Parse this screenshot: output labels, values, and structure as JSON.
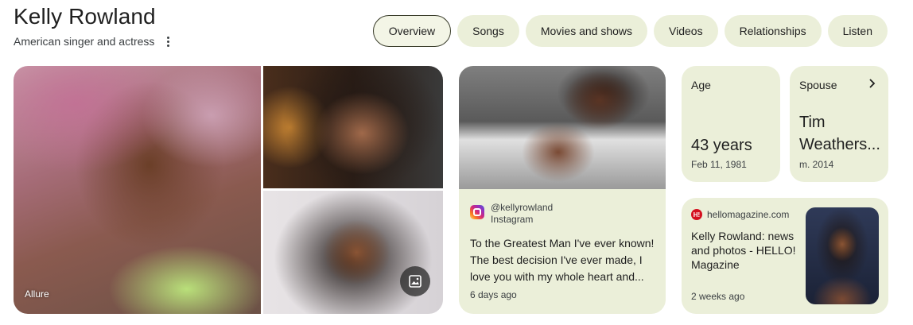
{
  "header": {
    "title": "Kelly Rowland",
    "subtitle": "American singer and actress"
  },
  "tabs": [
    {
      "label": "Overview",
      "active": true
    },
    {
      "label": "Songs"
    },
    {
      "label": "Movies and shows"
    },
    {
      "label": "Videos"
    },
    {
      "label": "Relationships"
    },
    {
      "label": "Listen"
    }
  ],
  "photos": {
    "main_source": "Allure",
    "gallery_icon": "image-gallery-icon"
  },
  "instagram_post": {
    "handle": "@kellyrowland",
    "platform": "Instagram",
    "text": "To the Greatest Man I've ever known! The best decision I've ever made, I love you with my whole heart and...",
    "time": "6 days ago",
    "icon": "instagram-icon"
  },
  "age": {
    "label": "Age",
    "value": "43 years",
    "sub": "Feb 11, 1981"
  },
  "spouse": {
    "label": "Spouse",
    "value_line1": "Tim",
    "value_line2": "Weathers...",
    "sub": "m. 2014",
    "icon": "chevron-right-icon"
  },
  "news": {
    "source": "hellomagazine.com",
    "logo_text": "H!",
    "title": "Kelly Rowland: news and photos - HELLO! Magazine",
    "time": "2 weeks ago"
  },
  "colors": {
    "card_bg": "#ebefd9",
    "active_tab_border": "#3a3d2b",
    "hello_red": "#d40f1e"
  }
}
